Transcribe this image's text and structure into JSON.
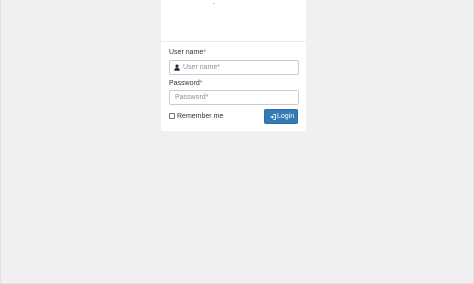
{
  "form": {
    "username_label": "User name",
    "username_placeholder": "User name*",
    "password_label": "Password",
    "password_placeholder": "Password*",
    "required_marker": "*",
    "remember_label": "Remember me",
    "login_label": "Login",
    "remember_checked": false
  },
  "icons": {
    "username": "user-icon",
    "login": "sign-in-icon"
  },
  "colors": {
    "background": "#f0f0f2",
    "card": "#ffffff",
    "primary_button": "#337ab7",
    "required": "#d9534f"
  }
}
